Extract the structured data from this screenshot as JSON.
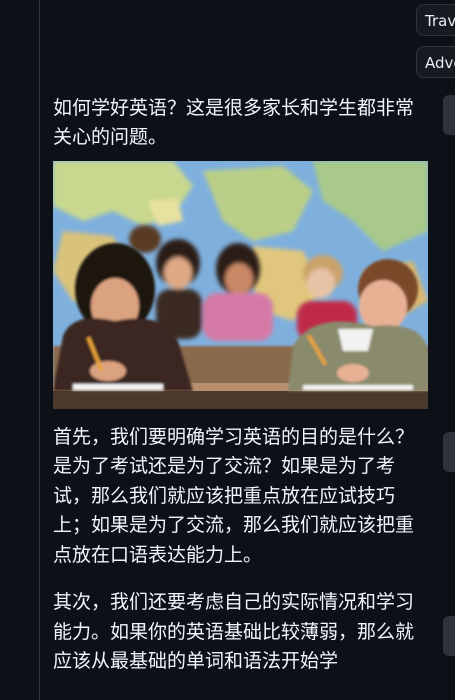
{
  "tags": [
    {
      "label": "Trav"
    },
    {
      "label": "Adve"
    }
  ],
  "article": {
    "intro": "如何学好英语？这是很多家长和学生都非常关心的问题。",
    "image": {
      "alt_icon": "classroom-photo"
    },
    "para2": "首先，我们要明确学习英语的目的是什么？是为了考试还是为了交流？如果是为了考试，那么我们就应该把重点放在应试技巧上；如果是为了交流，那么我们就应该把重点放在口语表达能力上。",
    "para3": "其次，我们还要考虑自己的实际情况和学习能力。如果你的英语基础比较薄弱，那么就应该从最基础的单词和语法开始学"
  }
}
